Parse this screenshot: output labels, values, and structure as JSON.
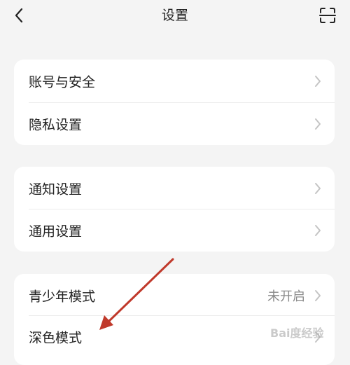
{
  "header": {
    "title": "设置",
    "back_icon": "chevron-left-icon",
    "scan_icon": "scan-icon"
  },
  "groups": [
    {
      "items": [
        {
          "label": "账号与安全",
          "value": ""
        },
        {
          "label": "隐私设置",
          "value": ""
        }
      ]
    },
    {
      "items": [
        {
          "label": "通知设置",
          "value": ""
        },
        {
          "label": "通用设置",
          "value": ""
        }
      ]
    },
    {
      "items": [
        {
          "label": "青少年模式",
          "value": "未开启"
        },
        {
          "label": "深色模式",
          "value": ""
        }
      ]
    }
  ],
  "annotation": {
    "arrow_color": "#c0392b",
    "target": "深色模式"
  },
  "watermark": {
    "text": "Bai度经验"
  },
  "colors": {
    "background": "#f4f4f4",
    "card": "#ffffff",
    "text": "#222222",
    "secondary_text": "#8a8a8a",
    "chevron": "#c4c4c4"
  }
}
